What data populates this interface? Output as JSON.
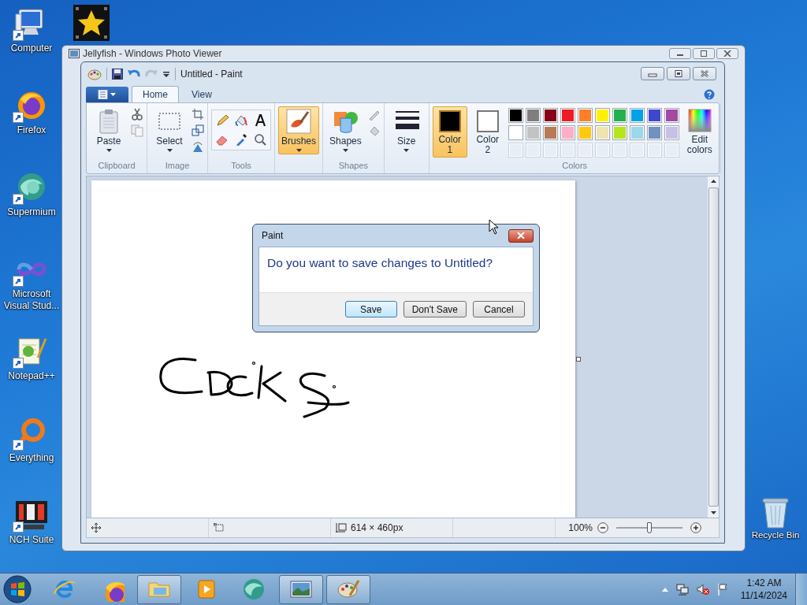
{
  "desktop_icons": [
    {
      "label": "Computer",
      "kind": "computer"
    },
    {
      "label": "Firefox",
      "kind": "firefox"
    },
    {
      "label": "Supermium",
      "kind": "supermium"
    },
    {
      "label": "Microsoft Visual Stud...",
      "kind": "vs"
    },
    {
      "label": "Notepad++",
      "kind": "notepad"
    },
    {
      "label": "Everything",
      "kind": "everything"
    },
    {
      "label": "NCH Suite",
      "kind": "nch"
    }
  ],
  "recycle_bin": {
    "label": "Recycle Bin"
  },
  "background_window": {
    "title": "Jellyfish - Windows Photo Viewer"
  },
  "paint": {
    "title": "Untitled - Paint",
    "tabs": [
      {
        "label": "Home",
        "selected": true
      },
      {
        "label": "View",
        "selected": false
      }
    ],
    "ribbon": [
      {
        "kind": "clipboard",
        "label": "Clipboard",
        "buttons": [
          {
            "label": "Paste",
            "selected": false
          }
        ]
      },
      {
        "kind": "image",
        "label": "Image",
        "buttons": [
          {
            "label": "Select",
            "selected": false
          }
        ]
      },
      {
        "kind": "tools",
        "label": "Tools"
      },
      {
        "kind": "brushes",
        "buttons": [
          {
            "label": "Brushes",
            "selected": true
          }
        ]
      },
      {
        "kind": "shapes",
        "label": "Shapes",
        "buttons": [
          {
            "label": "Shapes",
            "selected": false
          }
        ]
      },
      {
        "kind": "size",
        "buttons": [
          {
            "label": "Size",
            "selected": false
          }
        ]
      },
      {
        "kind": "colors",
        "label": "Colors",
        "buttons": [
          {
            "label": "Color 1",
            "selected": true,
            "color": "#000000"
          },
          {
            "label": "Color 2",
            "selected": false,
            "color": "#ffffff"
          },
          {
            "label": "Edit colors",
            "selected": false
          }
        ]
      }
    ],
    "palette": [
      {
        "color": "#000000"
      },
      {
        "color": "#7f7f7f"
      },
      {
        "color": "#880015"
      },
      {
        "color": "#ed1c24"
      },
      {
        "color": "#ff7f27"
      },
      {
        "color": "#fff200"
      },
      {
        "color": "#22b14c"
      },
      {
        "color": "#00a2e8"
      },
      {
        "color": "#3f48cc"
      },
      {
        "color": "#a349a4"
      },
      {
        "color": "#ffffff"
      },
      {
        "color": "#c3c3c3"
      },
      {
        "color": "#b97a57"
      },
      {
        "color": "#ffaec9"
      },
      {
        "color": "#ffc90e"
      },
      {
        "color": "#efe4b0"
      },
      {
        "color": "#b5e61d"
      },
      {
        "color": "#99d9ea"
      },
      {
        "color": "#7092be"
      },
      {
        "color": "#c8bfe7"
      }
    ],
    "status_bar": {
      "image_size": "614 × 460px",
      "zoom": "100%",
      "zoom_level": {
        "level": 0.5
      }
    }
  },
  "dialog": {
    "title": "Paint",
    "message": "Do you want to save changes to Untitled?",
    "buttons": [
      {
        "label": "Save",
        "default": true
      },
      {
        "label": "Don't Save",
        "default": false
      },
      {
        "label": "Cancel",
        "default": false
      }
    ]
  },
  "taskbar": {
    "items": [
      {
        "kind": "ie",
        "open": false
      },
      {
        "kind": "firefox",
        "open": false
      },
      {
        "kind": "explorer",
        "open": true
      },
      {
        "kind": "media",
        "open": false
      },
      {
        "kind": "supermium",
        "open": false
      },
      {
        "kind": "photos",
        "open": true
      },
      {
        "kind": "paint",
        "open": true
      }
    ],
    "time": "1:42 AM",
    "date": "11/14/2024"
  }
}
